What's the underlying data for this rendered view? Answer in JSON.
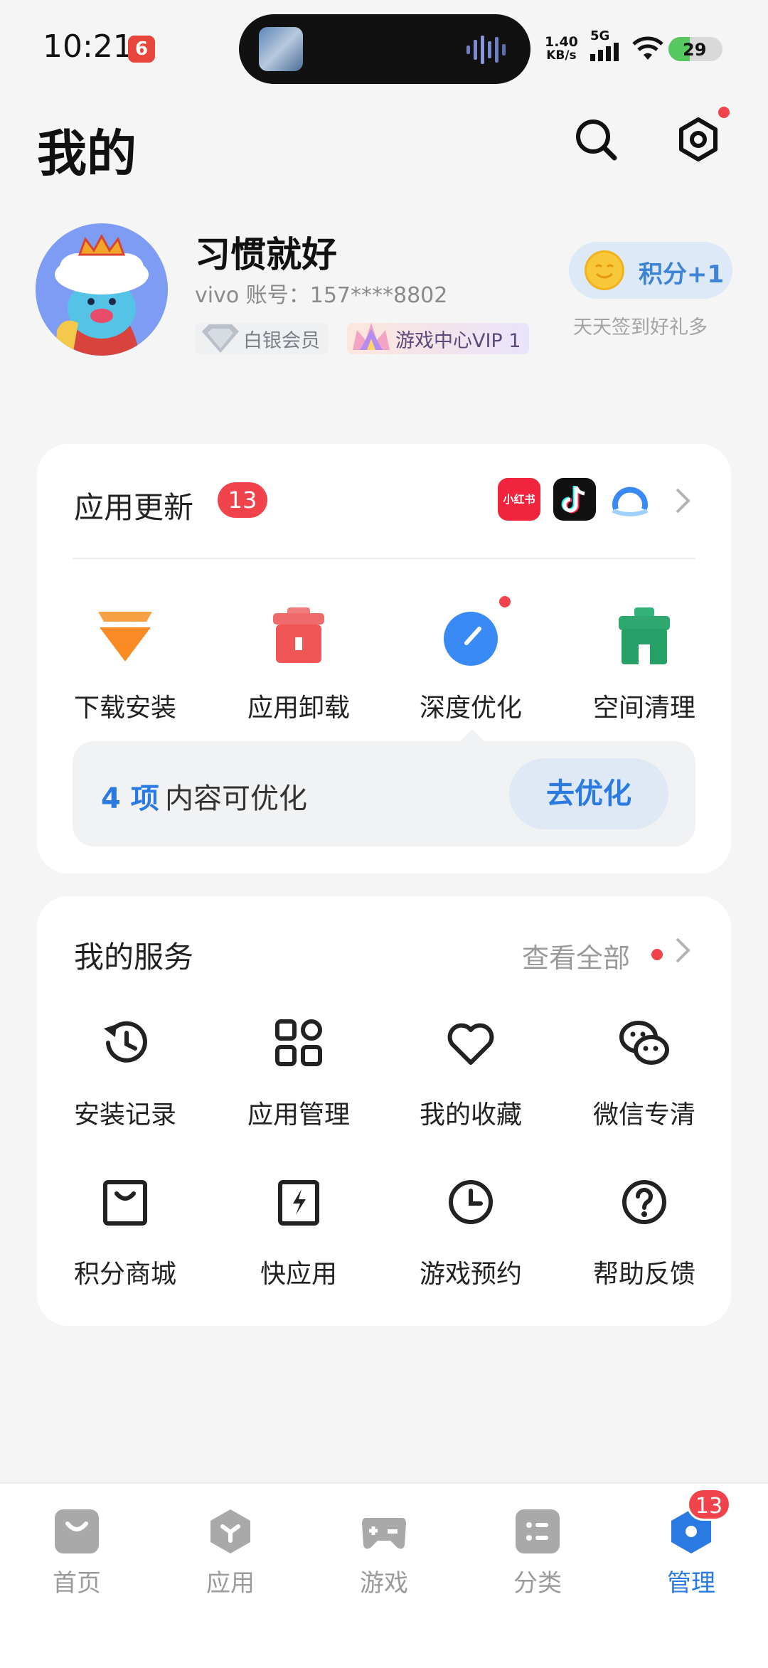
{
  "status_bar": {
    "time": "10:21",
    "net_speed_value": "1.40",
    "net_speed_unit": "KB/s",
    "network": "5G",
    "battery": "29"
  },
  "header": {
    "title": "我的"
  },
  "profile": {
    "username": "习惯就好",
    "account": "vivo 账号：157****8802",
    "badge_member": "白银会员",
    "badge_vip": "游戏中心VIP 1",
    "points_label": "积分+1",
    "points_sub": "天天签到好礼多"
  },
  "updates": {
    "title": "应用更新",
    "count": "13",
    "apps": [
      "小红书",
      "抖音",
      "浏览器"
    ],
    "tools": [
      {
        "label": "下载安装",
        "icon": "download-icon"
      },
      {
        "label": "应用卸载",
        "icon": "uninstall-icon"
      },
      {
        "label": "深度优化",
        "icon": "optimize-icon"
      },
      {
        "label": "空间清理",
        "icon": "clean-icon"
      }
    ],
    "tip_count": "4 项",
    "tip_text": "内容可优化",
    "tip_button": "去优化"
  },
  "services": {
    "title": "我的服务",
    "view_all": "查看全部",
    "items": [
      {
        "label": "安装记录",
        "icon": "history-icon"
      },
      {
        "label": "应用管理",
        "icon": "grid-icon"
      },
      {
        "label": "我的收藏",
        "icon": "heart-icon"
      },
      {
        "label": "微信专清",
        "icon": "wechat-icon"
      },
      {
        "label": "积分商城",
        "icon": "shop-icon"
      },
      {
        "label": "快应用",
        "icon": "quick-app-icon"
      },
      {
        "label": "游戏预约",
        "icon": "clock-icon"
      },
      {
        "label": "帮助反馈",
        "icon": "help-icon"
      }
    ]
  },
  "bottom_nav": {
    "items": [
      {
        "label": "首页",
        "icon": "home-icon"
      },
      {
        "label": "应用",
        "icon": "apps-icon"
      },
      {
        "label": "游戏",
        "icon": "gamepad-icon"
      },
      {
        "label": "分类",
        "icon": "category-icon"
      },
      {
        "label": "管理",
        "icon": "manage-icon",
        "active": true
      }
    ],
    "badge": "13"
  },
  "colors": {
    "accent": "#2a7ae2",
    "badge_red": "#f0434b",
    "background": "#f5f5f5"
  }
}
